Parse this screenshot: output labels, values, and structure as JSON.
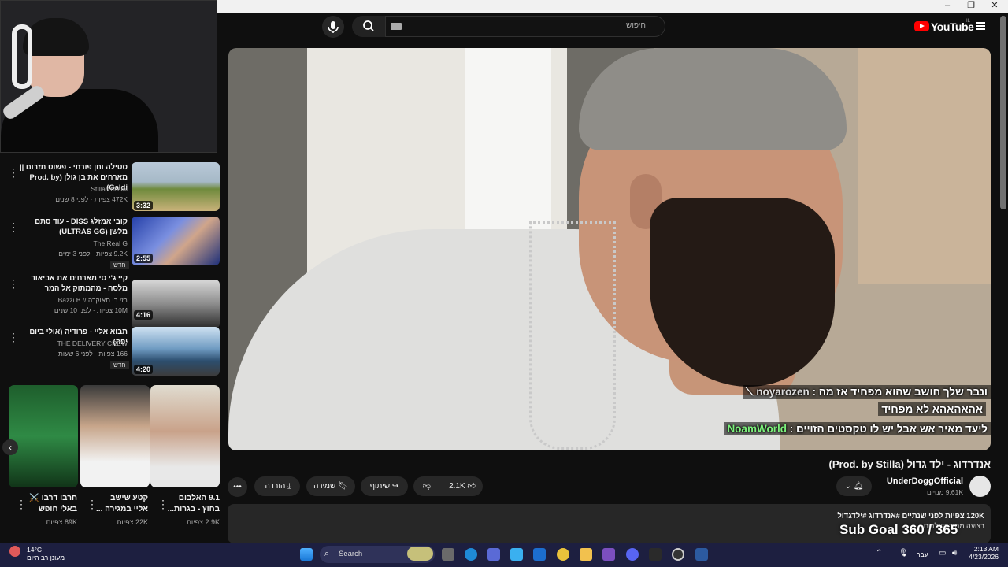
{
  "window": {
    "minimize": "–",
    "maximize": "❐",
    "close": "✕"
  },
  "header": {
    "search_placeholder": "חיפוש",
    "logo_text": "YouTube",
    "logo_region": "IL"
  },
  "sidebar_videos": [
    {
      "title": "סטילה וחן פורתי - פשוט תזרום || מארחים את בן גולן (Prod. by Galdi)",
      "channel": "Stilla Official",
      "meta": "472K צפיות · לפני 8 שנים",
      "duration": "3:32",
      "badge": ""
    },
    {
      "title": "קובי אמזלג DISS - עוד סתם מלשן (ULTRAS GG)",
      "channel": "The Real G",
      "meta": "9.2K צפיות · לפני 3 ימים",
      "duration": "2:55",
      "badge": "חדש"
    },
    {
      "title": "קיי ג'י סי מארחים את אביאור מלסה - מהמתוק אל המר",
      "channel": "בזי בי תאוקרה // Bazzi B",
      "meta": "10M צפיות · לפני 10 שנים",
      "duration": "4:16",
      "badge": ""
    },
    {
      "title": "תבוא אליי - פרודיה (אולי ביום יפה)",
      "channel": "THE DELIVERY CREW",
      "meta": "166 צפיות · לפני 6 שעות",
      "duration": "4:20",
      "badge": "חדש"
    }
  ],
  "shorts": [
    {
      "title": "9.1 האלבום בחוץ - בגרות...",
      "views": "2.9K צפיות"
    },
    {
      "title": "קטע שישב אליי במגירה ...",
      "views": "22K צפיות"
    },
    {
      "title": "חרבו דרבו ⚔️ באלי חופש",
      "views": "89K צפיות"
    }
  ],
  "chat": [
    {
      "user": "noyarozen",
      "text": "ונבר שלך חושב שהוא מפחיד אז מה : ",
      "text2": "אהאהאהא לא מפחיד"
    },
    {
      "user": "NoamWorld",
      "text": "ליעד מאיר אש אבל יש לו טקסטים הזויים : "
    }
  ],
  "video": {
    "title": "אנדרדוג - ילד גדול (Prod. by Stilla)",
    "channel": "UnderDoggOfficial",
    "subscribers": "9.61K מנויים",
    "likes": "2.1K",
    "share": "שיתוף",
    "save": "שמירה",
    "download": "הורדה",
    "more": "•••"
  },
  "description": {
    "stats": "120K צפיות  לפני שנתיים  #אנדרדוג #ילדגדול",
    "line2": "רצועה מתוך האלבום ..."
  },
  "overlay": {
    "sub_goal": "Sub Goal 360 / 365"
  },
  "taskbar": {
    "search": "Search",
    "temp": "14°C",
    "weather": "מעונן רב היום",
    "lang": "עבר",
    "time": "2:13 AM",
    "date": "4/23/2026"
  }
}
